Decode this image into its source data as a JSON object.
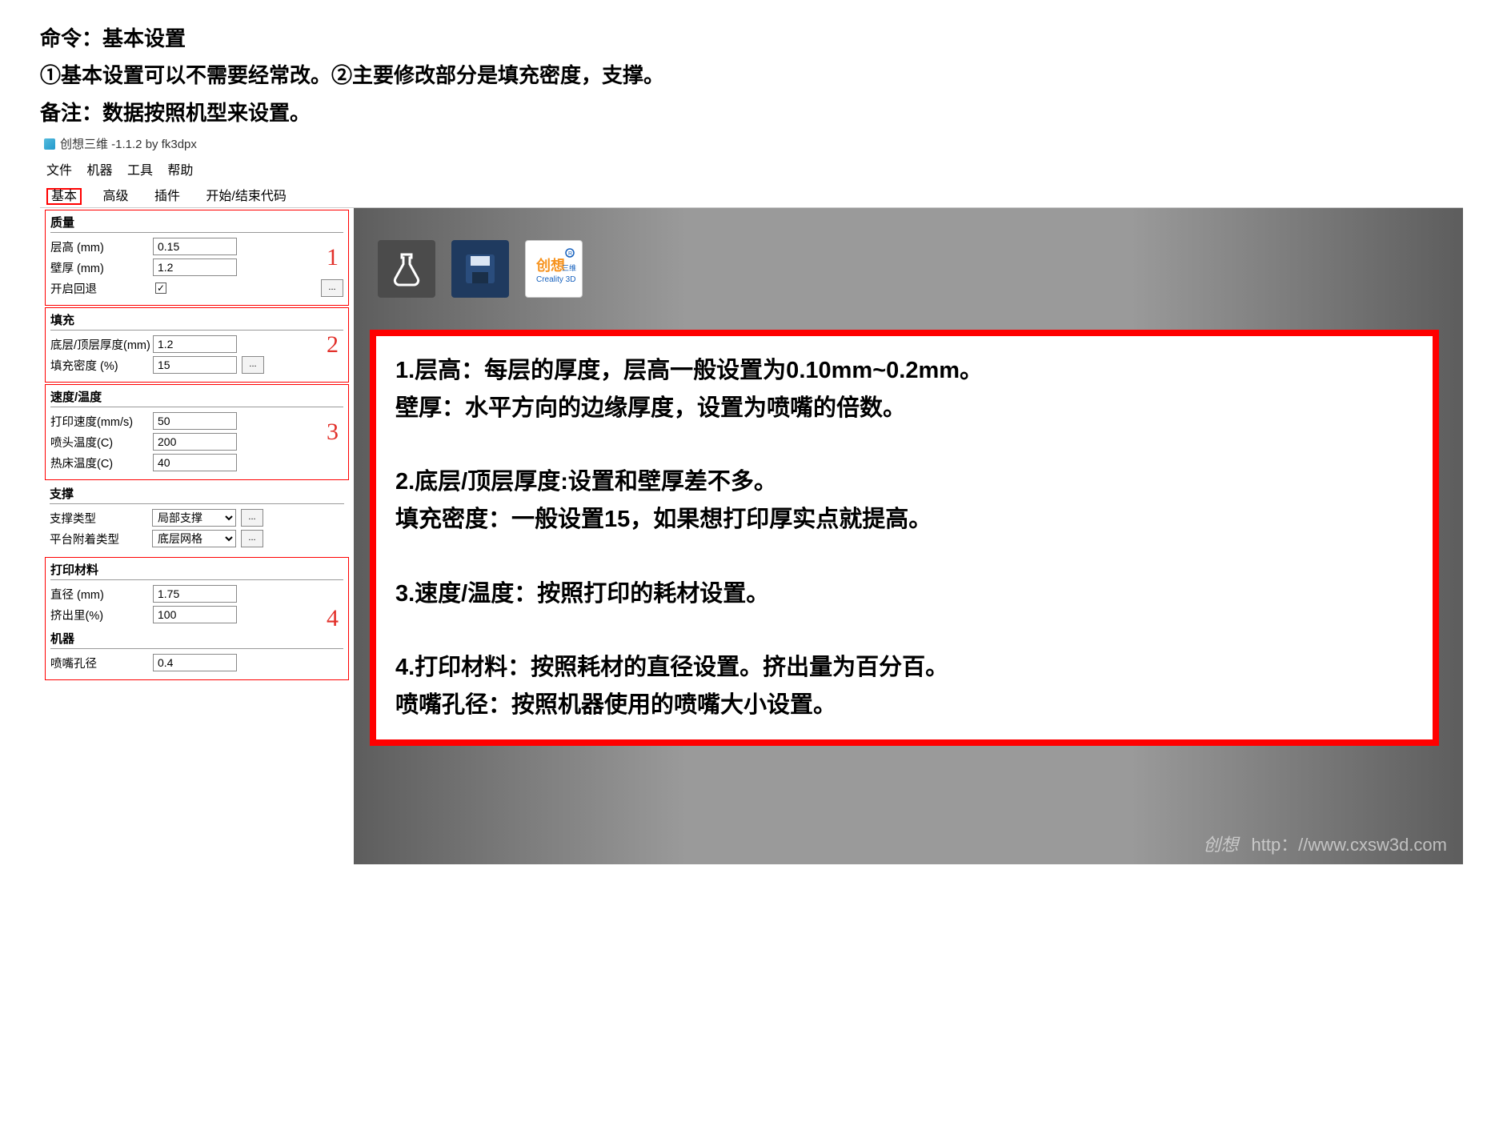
{
  "heading": {
    "line1": "命令：基本设置",
    "line2": "①基本设置可以不需要经常改。②主要修改部分是填充密度，支撑。",
    "line3": "备注：数据按照机型来设置。"
  },
  "app": {
    "title": "创想三维 -1.1.2 by fk3dpx"
  },
  "menubar": {
    "file": "文件",
    "machine": "机器",
    "tool": "工具",
    "help": "帮助"
  },
  "tabs": {
    "basic": "基本",
    "advanced": "高级",
    "plugins": "插件",
    "gcode": "开始/结束代码"
  },
  "panel": {
    "quality": {
      "title": "质量",
      "layer_height_label": "层高 (mm)",
      "layer_height_value": "0.15",
      "wall_thickness_label": "壁厚 (mm)",
      "wall_thickness_value": "1.2",
      "retraction_label": "开启回退",
      "badge": "1"
    },
    "fill": {
      "title": "填充",
      "topbot_label": "底层/顶层厚度(mm)",
      "topbot_value": "1.2",
      "density_label": "填充密度 (%)",
      "density_value": "15",
      "badge": "2"
    },
    "speedtemp": {
      "title": "速度/温度",
      "print_speed_label": "打印速度(mm/s)",
      "print_speed_value": "50",
      "nozzle_temp_label": "喷头温度(C)",
      "nozzle_temp_value": "200",
      "bed_temp_label": "热床温度(C)",
      "bed_temp_value": "40",
      "badge": "3"
    },
    "support": {
      "title": "支撑",
      "type_label": "支撑类型",
      "type_value": "局部支撑",
      "platform_label": "平台附着类型",
      "platform_value": "底层网格"
    },
    "material": {
      "title": "打印材料",
      "dia_label": "直径 (mm)",
      "dia_value": "1.75",
      "flow_label": "挤出里(%)",
      "flow_value": "100",
      "badge": "4"
    },
    "machine": {
      "title": "机器",
      "nozzle_dia_label": "喷嘴孔径",
      "nozzle_dia_value": "0.4"
    },
    "more": "..."
  },
  "info": {
    "p1a": "1.层高：每层的厚度，层高一般设置为0.10mm~0.2mm。",
    "p1b": "壁厚：水平方向的边缘厚度，设置为喷嘴的倍数。",
    "p2a": "2.底层/顶层厚度:设置和壁厚差不多。",
    "p2b": "填充密度：一般设置15，如果想打印厚实点就提高。",
    "p3": "3.速度/温度：按照打印的耗材设置。",
    "p4a": "4.打印材料：按照耗材的直径设置。挤出量为百分百。",
    "p4b": "喷嘴孔径：按照机器使用的喷嘴大小设置。"
  },
  "watermark": "http：//www.cxsw3d.com"
}
